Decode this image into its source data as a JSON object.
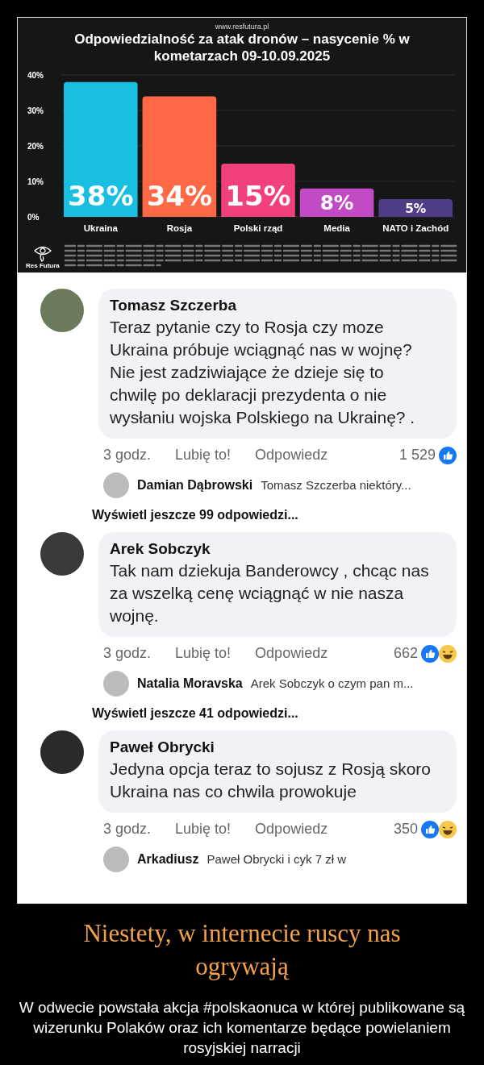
{
  "chart": {
    "source": "www.resfutura.pl",
    "logo_text": "Res Futura",
    "chart_data": {
      "type": "bar",
      "title": "Odpowiedzialność za atak dronów – nasycenie % w kometarzach 09-10.09.2025",
      "series": [
        {
          "name": "Ukraina",
          "color": "#18bfe0",
          "values": [
            38
          ]
        },
        {
          "name": "Rosja",
          "color": "#ff6845",
          "values": [
            34
          ]
        },
        {
          "name": "Polski rząd",
          "color": "#f2407e",
          "values": [
            15
          ]
        },
        {
          "name": "Media",
          "color": "#c24ac4",
          "values": [
            8
          ]
        },
        {
          "name": "NATO i Zachód",
          "color": "#4e3d86",
          "values": [
            5
          ]
        }
      ],
      "grid": true,
      "ylim": [
        0,
        40
      ],
      "yticks": [
        {
          "value": 0,
          "label": "0%"
        },
        {
          "value": 10,
          "label": "10%"
        },
        {
          "value": 20,
          "label": "20%"
        },
        {
          "value": 30,
          "label": "30%"
        },
        {
          "value": 40,
          "label": "40%"
        }
      ],
      "value_labels": [
        "38%",
        "34%",
        "15%",
        "8%",
        "5%"
      ]
    }
  },
  "comments": [
    {
      "name": "Tomasz Szczerba",
      "text": "Teraz pytanie czy to Rosja czy moze Ukraina próbuje wciągnąć nas w wojnę? Nie jest zadziwiające że dzieje się to chwilę po deklaracji prezydenta o nie wysłaniu wojska Polskiego na Ukrainę? .",
      "time": "3 godz.",
      "like": "Lubię to!",
      "reply": "Odpowiedz",
      "count": "1 529",
      "reactions": [
        {
          "kind": "like"
        }
      ],
      "replies": [
        {
          "name": "Damian Dąbrowski",
          "text": "Tomasz Szczerba niektóry..."
        }
      ],
      "more": "Wyświetl jeszcze 99 odpowiedzi..."
    },
    {
      "name": "Arek Sobczyk",
      "text": "Tak nam dziekuja Banderowcy , chcąc nas za wszelką cenę wciągnąć w nie nasza  wojnę.",
      "time": "3 godz.",
      "like": "Lubię to!",
      "reply": "Odpowiedz",
      "count": "662",
      "reactions": [
        {
          "kind": "like"
        },
        {
          "kind": "haha"
        }
      ],
      "replies": [
        {
          "name": "Natalia Moravska",
          "text": "Arek Sobczyk o czym pan m..."
        }
      ],
      "more": "Wyświetl jeszcze 41 odpowiedzi..."
    },
    {
      "name": "Paweł Obrycki",
      "text": "Jedyna opcja teraz to sojusz z Rosją skoro Ukraina nas co chwila prowokuje",
      "time": "3 godz.",
      "like": "Lubię to!",
      "reply": "Odpowiedz",
      "count": "350",
      "reactions": [
        {
          "kind": "like"
        },
        {
          "kind": "haha"
        }
      ],
      "replies": [
        {
          "name": "Arkadiusz",
          "text": "Paweł Obrycki i cyk 7 zł w"
        }
      ]
    }
  ],
  "caption": {
    "title": "Niestety, w internecie ruscy nas ogrywają",
    "text": "W odwecie powstała akcja #polskaonuca w której publikowane są wizerunku Polaków oraz ich komentarze będące powielaniem rosyjskiej narracji"
  }
}
